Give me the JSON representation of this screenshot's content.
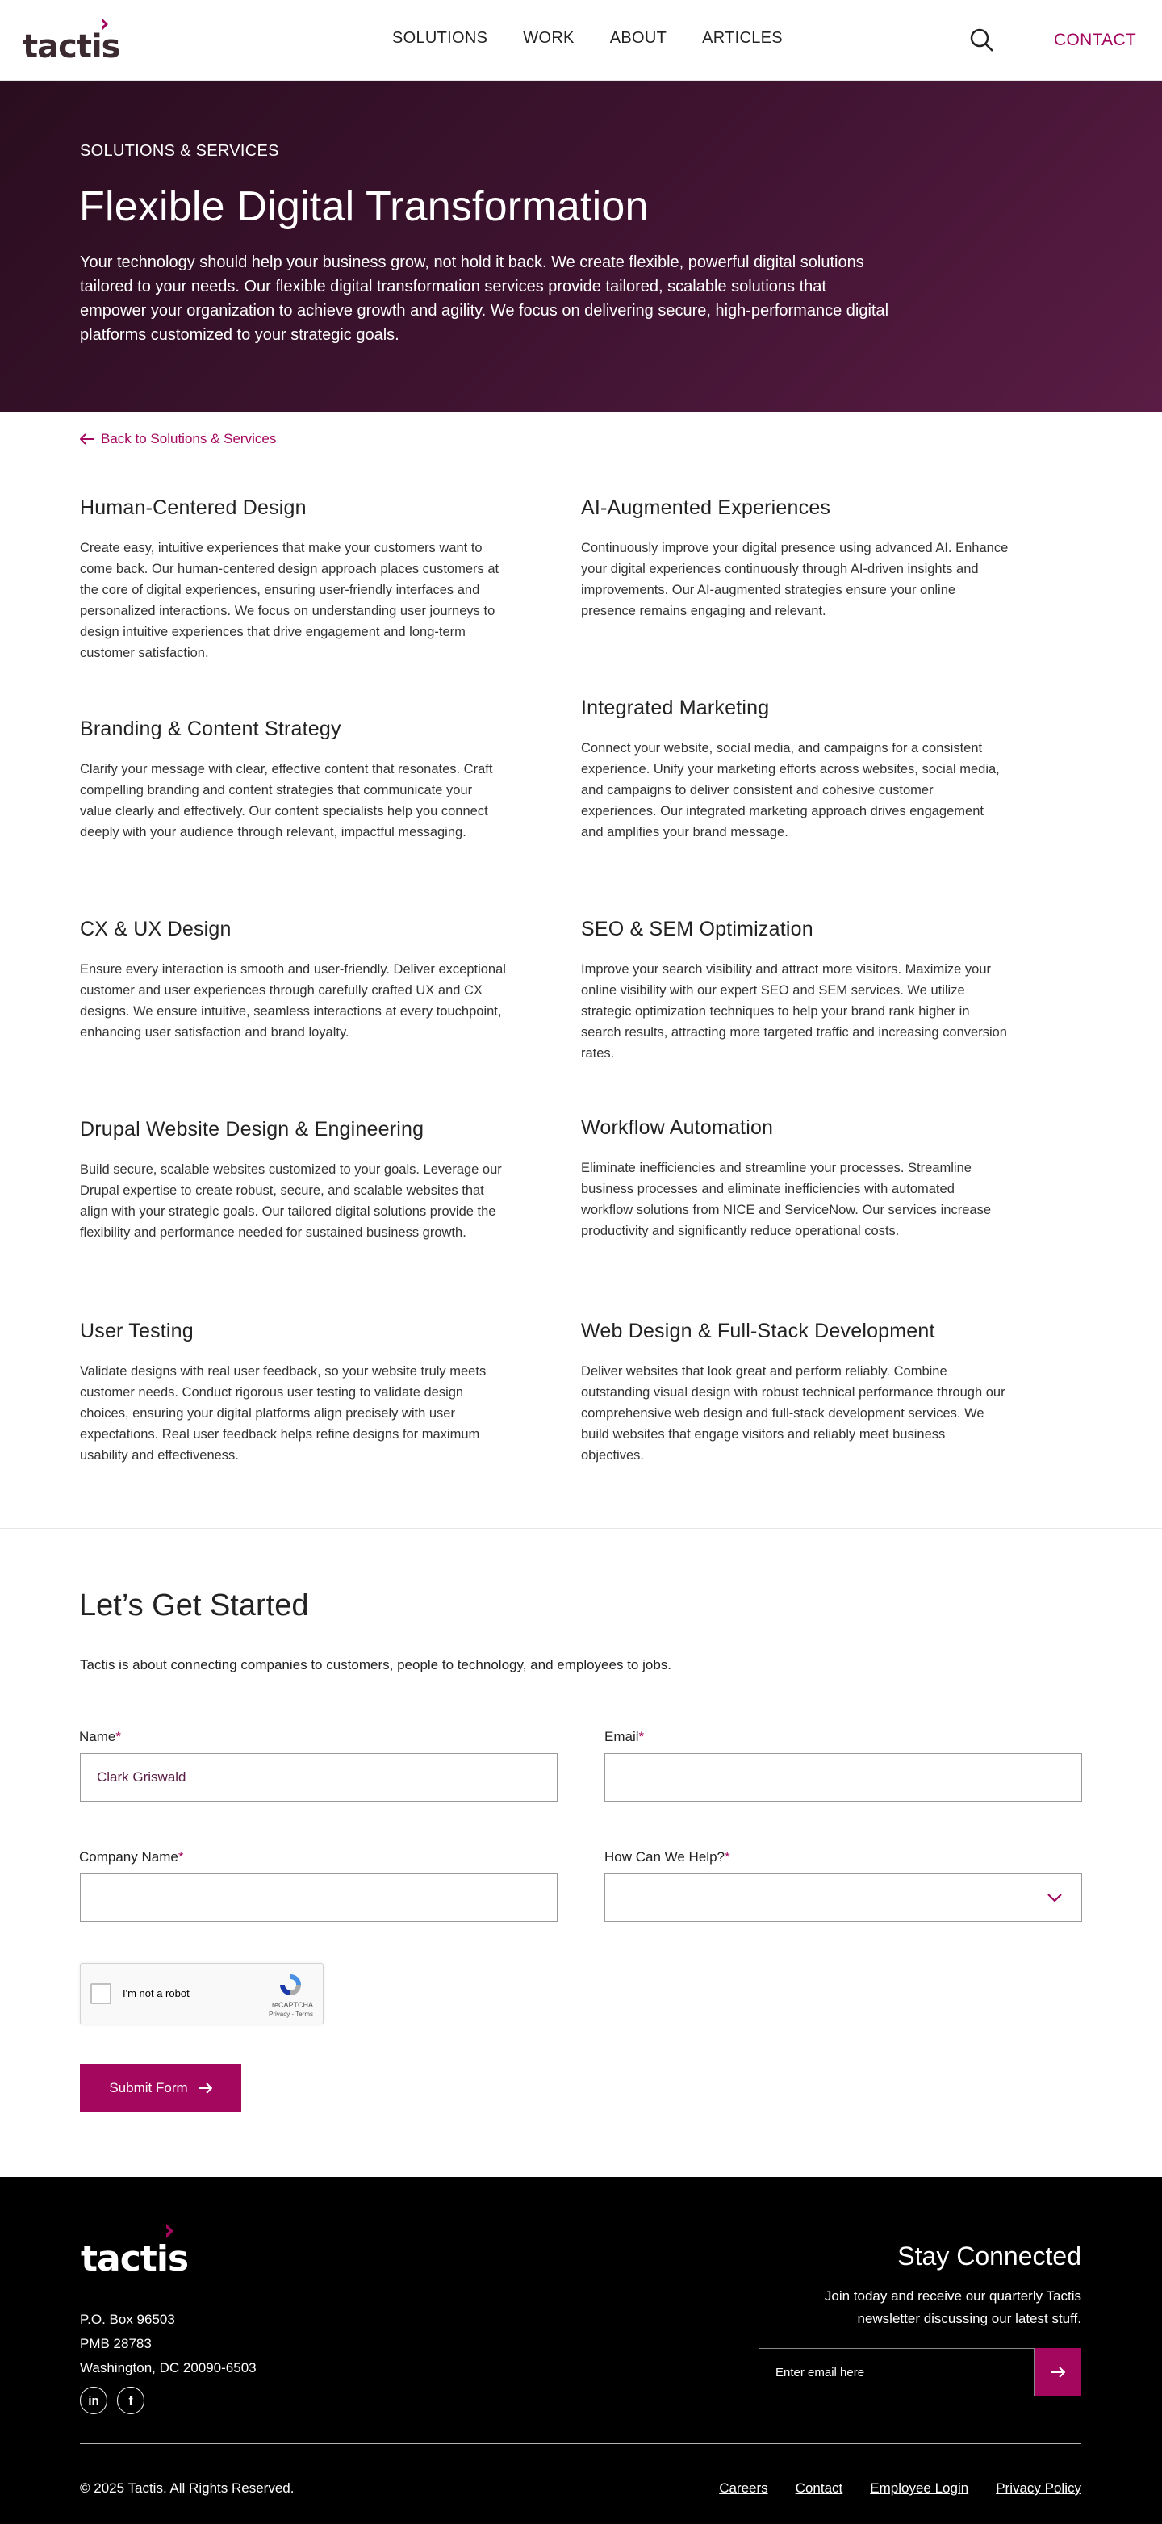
{
  "header": {
    "logo": "tactis",
    "nav": [
      "SOLUTIONS",
      "WORK",
      "ABOUT",
      "ARTICLES"
    ],
    "contact": "CONTACT"
  },
  "hero": {
    "eyebrow": "SOLUTIONS & SERVICES",
    "title": "Flexible Digital Transformation",
    "text": "Your technology should help your business grow, not hold it back. We create flexible, powerful digital solutions tailored to your needs. Our flexible digital transformation services provide tailored, scalable solutions that empower your organization to achieve growth and agility. We focus on delivering secure, high-performance digital platforms customized to your strategic goals."
  },
  "back_link": "Back to Solutions & Services",
  "services": [
    {
      "title": "Human-Centered Design",
      "text": "Create easy, intuitive experiences that make your customers want to come back. Our human-centered design approach places customers at the core of digital experiences, ensuring user-friendly interfaces and personalized interactions. We focus on understanding user journeys to design intuitive experiences that drive engagement and long-term customer satisfaction."
    },
    {
      "title": "AI-Augmented Experiences",
      "text": "Continuously improve your digital presence using advanced AI. Enhance your digital experiences continuously through AI-driven insights and improvements. Our AI-augmented strategies ensure your online presence remains engaging and relevant."
    },
    {
      "title": "Branding & Content Strategy",
      "text": "Clarify your message with clear, effective content that resonates. Craft compelling branding and content strategies that communicate your value clearly and effectively. Our content specialists help you connect deeply with your audience through relevant, impactful messaging."
    },
    {
      "title": "Integrated Marketing",
      "text": "Connect your website, social media, and campaigns for a consistent experience. Unify your marketing efforts across websites, social media, and campaigns to deliver consistent and cohesive customer experiences. Our integrated marketing approach drives engagement and amplifies your brand message."
    },
    {
      "title": "CX & UX Design",
      "text": "Ensure every interaction is smooth and user-friendly. Deliver exceptional customer and user experiences through carefully crafted UX and CX designs. We ensure intuitive, seamless interactions at every touchpoint, enhancing user satisfaction and brand loyalty."
    },
    {
      "title": "SEO & SEM Optimization",
      "text": "Improve your search visibility and attract more visitors. Maximize your online visibility with our expert SEO and SEM services. We utilize strategic optimization techniques to help your brand rank higher in search results, attracting more targeted traffic and increasing conversion rates."
    },
    {
      "title": "Drupal Website Design & Engineering",
      "text": "Build secure, scalable websites customized to your goals. Leverage our Drupal expertise to create robust, secure, and scalable websites that align with your strategic goals. Our tailored digital solutions provide the flexibility and performance needed for sustained business growth."
    },
    {
      "title": "Workflow Automation",
      "text": "Eliminate inefficiencies and streamline your processes. Streamline business processes and eliminate inefficiencies with automated workflow solutions from NICE and ServiceNow. Our services increase productivity and significantly reduce operational costs."
    },
    {
      "title": "User Testing",
      "text": "Validate designs with real user feedback, so your website truly meets customer needs. Conduct rigorous user testing to validate design choices, ensuring your digital platforms align precisely with user expectations. Real user feedback helps refine designs for maximum usability and effectiveness."
    },
    {
      "title": "Web Design & Full-Stack Development",
      "text": "Deliver websites that look great and perform reliably. Combine outstanding visual design with robust technical performance through our comprehensive web design and full-stack development services. We build websites that engage visitors and reliably meet business objectives."
    }
  ],
  "cta": {
    "title": "Let’s Get Started",
    "subtitle": "Tactis is about connecting companies to customers, people to technology, and employees to jobs.",
    "required_mark": "*",
    "name_label": "Name",
    "name_value": "Clark Griswald",
    "email_label": "Email",
    "email_value": "",
    "company_label": "Company Name",
    "company_value": "",
    "help_label": "How Can We Help?",
    "help_value": "",
    "recaptcha_label": "I'm not a robot",
    "recaptcha_brand": "reCAPTCHA",
    "recaptcha_terms": "Privacy - Terms",
    "submit": "Submit Form"
  },
  "footer": {
    "logo": "tactis",
    "address": [
      "P.O. Box 96503",
      "PMB 28783",
      "Washington, DC 20090-6503"
    ],
    "social": [
      "in",
      "f"
    ],
    "stay_title": "Stay Connected",
    "stay_text": "Join today and receive our quarterly Tactis newsletter discussing our latest stuff.",
    "email_placeholder": "Enter email here",
    "copyright": "© 2025 Tactis. All Rights Reserved.",
    "links": [
      "Careers",
      "Contact",
      "Employee Login",
      "Privacy Policy"
    ]
  },
  "colors": {
    "accent": "#a3085e",
    "hero_dark": "#2a0d1f",
    "footer_bg": "#000000"
  }
}
